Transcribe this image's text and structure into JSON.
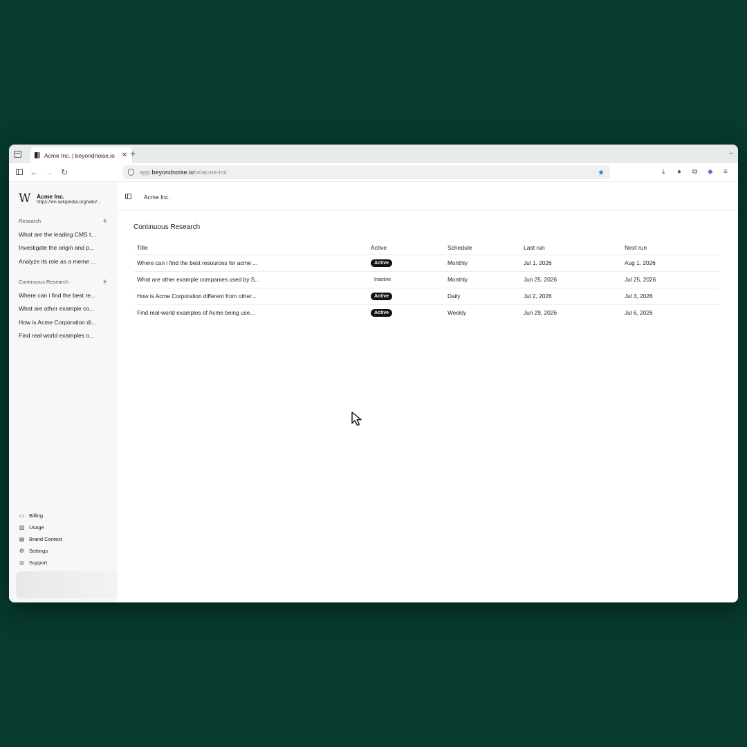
{
  "colors": {
    "background": "#083a2f",
    "accent_star": "#2b6ff0",
    "badge_active": "#111111"
  },
  "browser": {
    "tab_title": "Acme Inc. | beyondnoise.io",
    "tab_close": "✕",
    "new_tab": "+",
    "url_prefix": "app.",
    "url_host": "beyondnoise.io",
    "url_path": "/w/acme-inc"
  },
  "workspace": {
    "logo": "W",
    "name": "Acme Inc.",
    "url": "https://en.wikipedia.org/wiki/..."
  },
  "sidebar": {
    "research_label": "Research",
    "research_items": [
      "What are the leading CMS t...",
      "Investigate the origin and p...",
      "Analyze its role as a meme ..."
    ],
    "continuous_label": "Continuous Research",
    "continuous_items": [
      "Where can i find the best re...",
      "What are other example co...",
      "How is Acme Corporation di...",
      "Find real-world examples o..."
    ],
    "footer": [
      {
        "label": "Billing",
        "icon": "card-icon"
      },
      {
        "label": "Usage",
        "icon": "bar-chart-icon"
      },
      {
        "label": "Brand Context",
        "icon": "book-icon"
      },
      {
        "label": "Settings",
        "icon": "gear-icon"
      },
      {
        "label": "Support",
        "icon": "lifebuoy-icon"
      }
    ]
  },
  "main": {
    "breadcrumb": "Acme Inc.",
    "page_title": "Continuous Research",
    "columns": [
      "Title",
      "Active",
      "Schedule",
      "Last run",
      "Next run"
    ],
    "rows": [
      {
        "title": "Where can i find the best resources for acme ...",
        "active": "Active",
        "schedule": "Monthly",
        "last_run": "Jul 1, 2026",
        "next_run": "Aug 1, 2026"
      },
      {
        "title": "What are other example companies used by S...",
        "active": "Inactive",
        "schedule": "Monthly",
        "last_run": "Jun 25, 2026",
        "next_run": "Jul 25, 2026"
      },
      {
        "title": "How is Acme Corporation different from other...",
        "active": "Active",
        "schedule": "Daily",
        "last_run": "Jul 2, 2026",
        "next_run": "Jul 3, 2026"
      },
      {
        "title": "Find real-world examples of Acme being use...",
        "active": "Active",
        "schedule": "Weekly",
        "last_run": "Jun 29, 2026",
        "next_run": "Jul 6, 2026"
      }
    ]
  }
}
